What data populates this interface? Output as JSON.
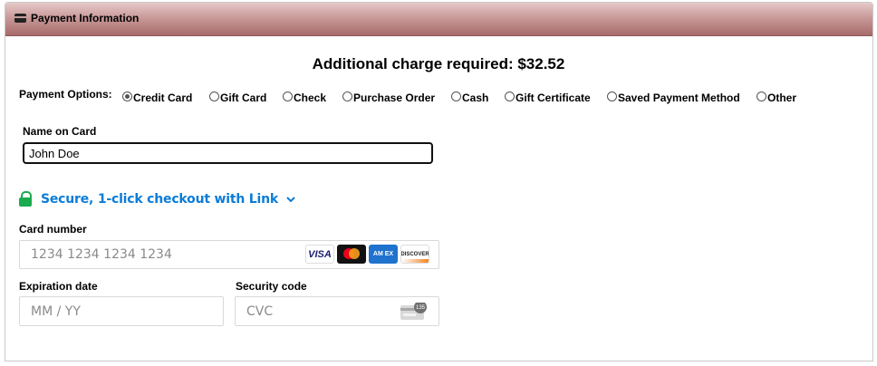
{
  "header": {
    "title": "Payment Information"
  },
  "charge_text": "Additional charge required: $32.52",
  "payment_options": {
    "label": "Payment Options:",
    "selected": "Credit Card",
    "options": [
      "Credit Card",
      "Gift Card",
      "Check",
      "Purchase Order",
      "Cash",
      "Gift Certificate",
      "Saved Payment Method",
      "Other"
    ]
  },
  "name_on_card": {
    "label": "Name on Card",
    "value": "John Doe"
  },
  "link": {
    "text": "Secure, 1-click checkout with Link",
    "accent": "#0a7cd8",
    "lock_color": "#1aab4f"
  },
  "card_number": {
    "label": "Card number",
    "placeholder": "1234 1234 1234 1234",
    "brands": {
      "visa": "VISA",
      "amex": "AM EX",
      "discover": "DISCOVER"
    }
  },
  "expiration": {
    "label": "Expiration date",
    "placeholder": "MM / YY"
  },
  "security_code": {
    "label": "Security code",
    "placeholder": "CVC",
    "icon_text": "135"
  },
  "colors": {
    "header_gradient_top": "#e7c9c9",
    "header_gradient_bottom": "#a86a6a"
  }
}
